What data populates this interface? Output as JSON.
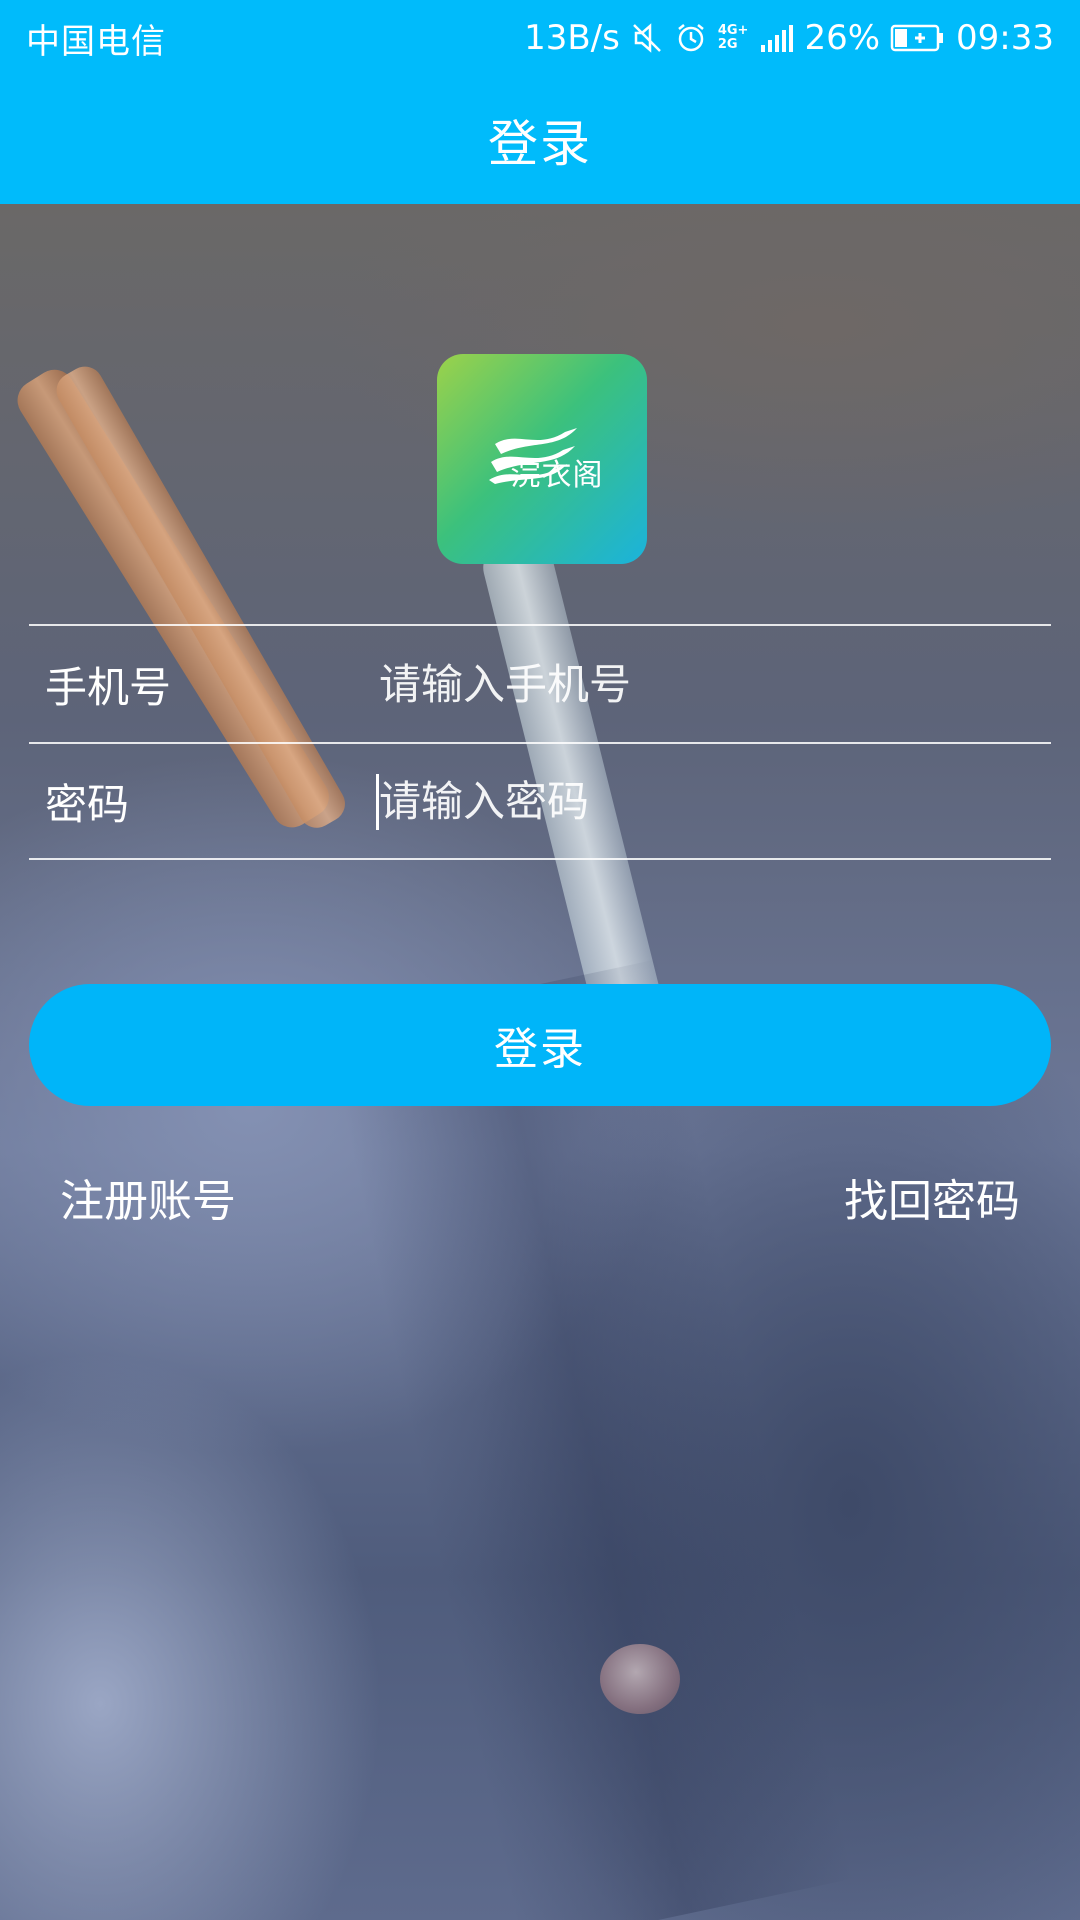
{
  "status_bar": {
    "carrier": "中国电信",
    "speed": "13B/s",
    "net_type_top": "4G+",
    "net_type_bottom": "2G",
    "battery": "26%",
    "time": "09:33",
    "icons": [
      "mute-icon",
      "alarm-icon",
      "signal-icon",
      "battery-charging-icon"
    ]
  },
  "header": {
    "title": "登录"
  },
  "logo": {
    "text": "浣衣阁"
  },
  "form": {
    "phone": {
      "label": "手机号",
      "placeholder": "请输入手机号",
      "value": ""
    },
    "password": {
      "label": "密码",
      "placeholder": "请输入密码",
      "value": ""
    }
  },
  "login_button": {
    "label": "登录"
  },
  "links": {
    "register": "注册账号",
    "forgot_password": "找回密码"
  },
  "colors": {
    "accent": "#00bbfb",
    "button": "#00b5f9"
  }
}
